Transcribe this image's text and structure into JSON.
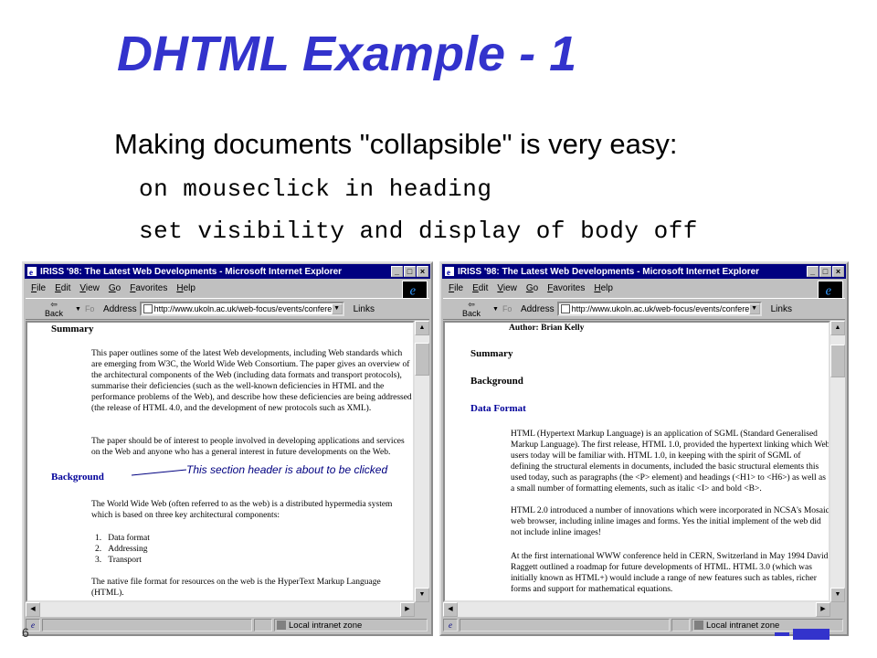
{
  "slide": {
    "title": "DHTML Example - 1",
    "subtitle": "Making documents \"collapsible\" is very easy:",
    "code_lines": [
      "on mouseclick in heading",
      "set visibility and display of body off"
    ],
    "page_number": "6"
  },
  "browser": {
    "window_title": "IRISS '98: The Latest Web Developments - Microsoft Internet Explorer",
    "menu": [
      "File",
      "Edit",
      "View",
      "Go",
      "Favorites",
      "Help"
    ],
    "back_label": "Back",
    "forward_label": "Fo",
    "address_label": "Address",
    "address_value": "http://www.ukoln.ac.uk/web-focus/events/confere",
    "links_label": "Links",
    "status_zone": "Local intranet zone"
  },
  "left_page": {
    "summary_heading": "Summary",
    "summary_p1": "This paper outlines some of the latest Web developments, including Web standards which are emerging from W3C, the World Wide Web Consortium. The paper gives an overview of the architectural components of the Web (including data formats and transport protocols), summarise their deficiencies (such as the well-known deficiencies in HTML and the performance problems of the Web), and describe how these deficiencies are being addressed (the release of HTML 4.0, and the development of new protocols such as XML).",
    "summary_p2": "The paper should be of interest to people involved in developing applications and services on the Web and anyone who has a general interest in future developments on the Web.",
    "background_heading": "Background",
    "annotation": "This section header is about to be clicked",
    "background_p1": "The World Wide Web (often referred to as the web) is a distributed hypermedia system which is based on three key architectural components:",
    "list": [
      "Data format",
      "Addressing",
      "Transport"
    ],
    "list_numbers": [
      "1.",
      "2.",
      "3."
    ],
    "background_p2": "The native file format for resources on the web is the HyperText Markup Language (HTML)."
  },
  "right_page": {
    "author": "Author: Brian Kelly",
    "summary_heading": "Summary",
    "background_heading": "Background",
    "dataformat_heading": "Data Format",
    "p1": "HTML (Hypertext Markup Language) is an application of SGML (Standard Generalised Markup Language). The first release, HTML 1.0, provided the hypertext linking which Web users today will be familiar with. HTML 1.0, in keeping with the spirit of SGML of defining the structural elements in documents, included the basic structural elements this used today, such as paragraphs (the <P> element) and headings (<H1> to <H6>) as well as a small number of formatting elements, such as italic <I> and bold <B>.",
    "p2": "HTML 2.0 introduced a number of innovations which were incorporated in NCSA's Mosaic web browser, including inline images and forms. Yes the initial implement of the web did not include inline images!",
    "p3": "At the first international WWW conference held in CERN, Switzerland in May 1994 David Raggett outlined a roadmap for future developments of HTML. HTML 3.0 (which was initially known as HTML+) would include a range of new features such as tables, richer forms and support for mathematical equations."
  }
}
